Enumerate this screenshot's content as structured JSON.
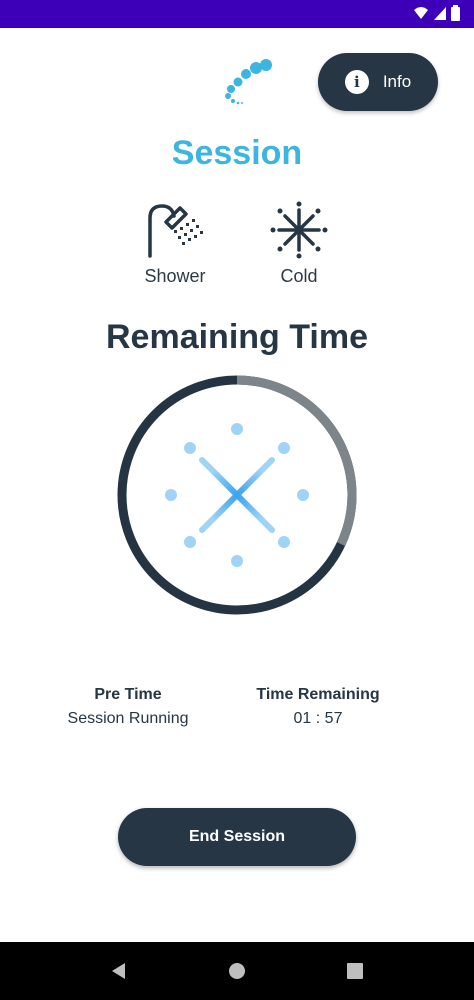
{
  "header": {
    "info_label": "Info"
  },
  "session": {
    "title": "Session",
    "modes": [
      {
        "label": "Shower",
        "icon": "shower-icon"
      },
      {
        "label": "Cold",
        "icon": "snowflake-icon"
      }
    ]
  },
  "timer": {
    "title": "Remaining Time",
    "progress": 0.32,
    "colors": {
      "remaining": "#243442",
      "elapsed": "#7d858b",
      "snowflake": "#57b4f2"
    }
  },
  "stats": {
    "pre_time_label": "Pre Time",
    "pre_time_value": "Session Running",
    "time_remaining_label": "Time Remaining",
    "time_remaining_value": "01 : 57"
  },
  "actions": {
    "end_session_label": "End Session"
  },
  "colors": {
    "status_bar": "#3d00b8",
    "accent": "#3cb5e0",
    "primary_dark": "#263645"
  }
}
